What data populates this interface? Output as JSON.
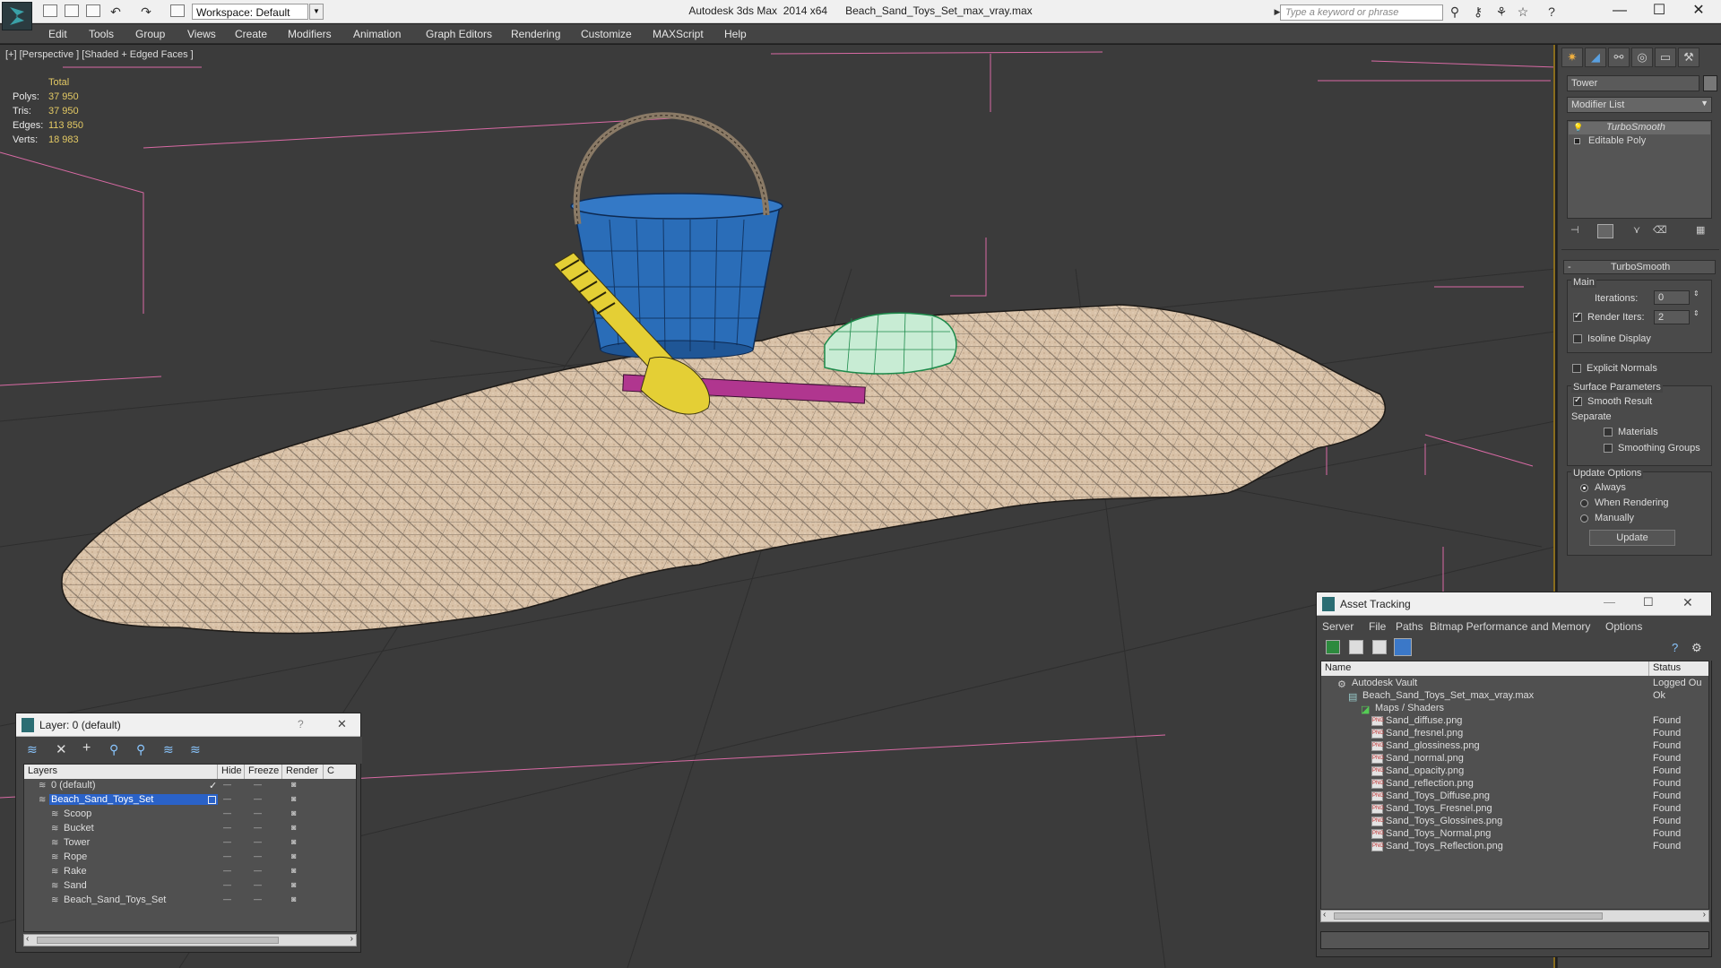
{
  "titlebar": {
    "workspace": "Workspace: Default",
    "app_title": "Autodesk 3ds Max  2014 x64      Beach_Sand_Toys_Set_max_vray.max",
    "search_placeholder": "Type a keyword or phrase",
    "window_buttons": [
      "—",
      "☐",
      "✕"
    ]
  },
  "menu": [
    "Edit",
    "Tools",
    "Group",
    "Views",
    "Create",
    "Modifiers",
    "Animation",
    "Graph Editors",
    "Rendering",
    "Customize",
    "MAXScript",
    "Help"
  ],
  "viewport": {
    "label": "[+] [Perspective ] [Shaded + Edged Faces ]",
    "stats": {
      "total_label": "Total",
      "rows": [
        {
          "key": "Polys:",
          "value": "37 950"
        },
        {
          "key": "Tris:",
          "value": "37 950"
        },
        {
          "key": "Edges:",
          "value": "113 850"
        },
        {
          "key": "Verts:",
          "value": "18 983"
        }
      ]
    }
  },
  "command_panel": {
    "object_name": "Tower",
    "modifier_list": "Modifier List",
    "stack": [
      "TurboSmooth",
      "Editable Poly"
    ],
    "turbosmooth": {
      "title": "TurboSmooth",
      "main_label": "Main",
      "iterations_label": "Iterations:",
      "iterations_value": "0",
      "render_iters_label": "Render Iters:",
      "render_iters_value": "2",
      "isoline": "Isoline Display",
      "explicit_normals": "Explicit Normals",
      "surface_params": "Surface Parameters",
      "smooth_result": "Smooth Result",
      "separate": "Separate",
      "materials": "Materials",
      "smoothing_groups": "Smoothing Groups",
      "update_options": "Update Options",
      "always": "Always",
      "when_rendering": "When Rendering",
      "manually": "Manually",
      "update_button": "Update"
    }
  },
  "layer_window": {
    "title": "Layer: 0 (default)",
    "help": "?",
    "close": "✕",
    "columns": [
      "Layers",
      "Hide",
      "Freeze",
      "Render",
      "C"
    ],
    "rows": [
      {
        "name": "0 (default)",
        "indent": 1,
        "selected": false
      },
      {
        "name": "Beach_Sand_Toys_Set",
        "indent": 1,
        "selected": true
      },
      {
        "name": "Scoop",
        "indent": 2,
        "selected": false
      },
      {
        "name": "Bucket",
        "indent": 2,
        "selected": false
      },
      {
        "name": "Tower",
        "indent": 2,
        "selected": false
      },
      {
        "name": "Rope",
        "indent": 2,
        "selected": false
      },
      {
        "name": "Rake",
        "indent": 2,
        "selected": false
      },
      {
        "name": "Sand",
        "indent": 2,
        "selected": false
      },
      {
        "name": "Beach_Sand_Toys_Set",
        "indent": 2,
        "selected": false
      }
    ]
  },
  "asset_window": {
    "title": "Asset Tracking",
    "menu": [
      "Server",
      "File",
      "Paths",
      "Bitmap Performance and Memory",
      "Options"
    ],
    "columns": [
      "Name",
      "Status"
    ],
    "rows": [
      {
        "name": "Autodesk Vault",
        "status": "Logged Ou",
        "indent": 1,
        "type": "vault"
      },
      {
        "name": "Beach_Sand_Toys_Set_max_vray.max",
        "status": "Ok",
        "indent": 2,
        "type": "max"
      },
      {
        "name": "Maps / Shaders",
        "status": "",
        "indent": 3,
        "type": "maps"
      },
      {
        "name": "Sand_diffuse.png",
        "status": "Found",
        "indent": 4,
        "type": "png"
      },
      {
        "name": "Sand_fresnel.png",
        "status": "Found",
        "indent": 4,
        "type": "png"
      },
      {
        "name": "Sand_glossiness.png",
        "status": "Found",
        "indent": 4,
        "type": "png"
      },
      {
        "name": "Sand_normal.png",
        "status": "Found",
        "indent": 4,
        "type": "png"
      },
      {
        "name": "Sand_opacity.png",
        "status": "Found",
        "indent": 4,
        "type": "png"
      },
      {
        "name": "Sand_reflection.png",
        "status": "Found",
        "indent": 4,
        "type": "png"
      },
      {
        "name": "Sand_Toys_Diffuse.png",
        "status": "Found",
        "indent": 4,
        "type": "png"
      },
      {
        "name": "Sand_Toys_Fresnel.png",
        "status": "Found",
        "indent": 4,
        "type": "png"
      },
      {
        "name": "Sand_Toys_Glossines.png",
        "status": "Found",
        "indent": 4,
        "type": "png"
      },
      {
        "name": "Sand_Toys_Normal.png",
        "status": "Found",
        "indent": 4,
        "type": "png"
      },
      {
        "name": "Sand_Toys_Reflection.png",
        "status": "Found",
        "indent": 4,
        "type": "png"
      }
    ]
  }
}
